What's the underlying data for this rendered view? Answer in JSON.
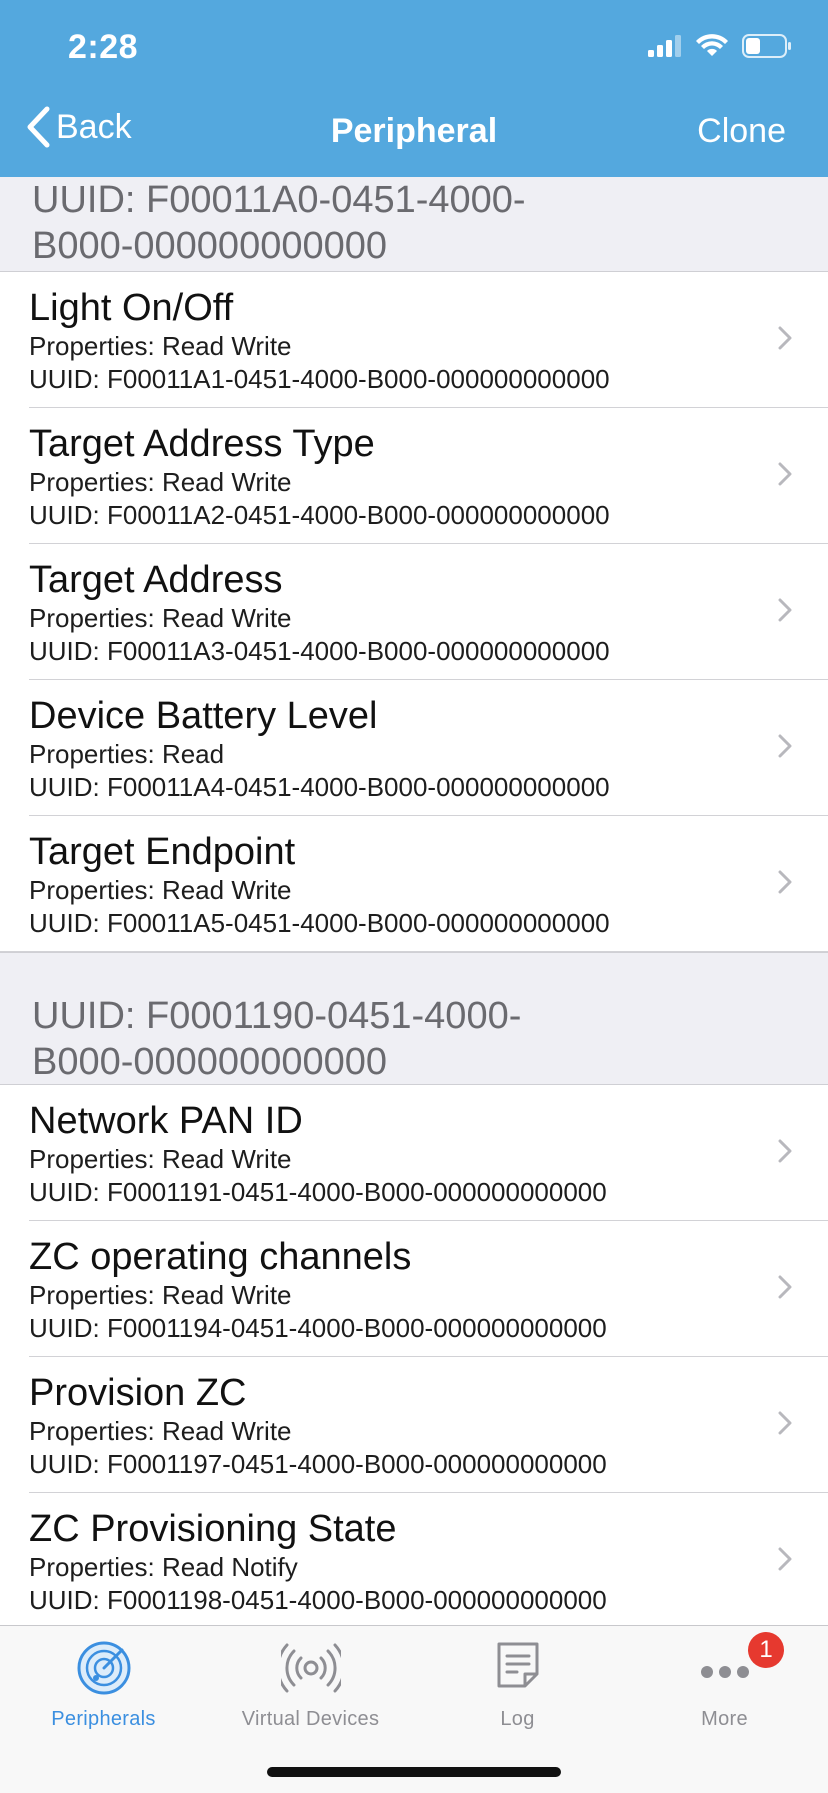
{
  "status_bar": {
    "time": "2:28"
  },
  "nav": {
    "back_label": "Back",
    "title": "Peripheral",
    "action_label": "Clone"
  },
  "sections": [
    {
      "header": "UUID: F00011A0-0451-4000-B000-000000000000",
      "header_line1": "UUID: F00011A0-0451-4000-",
      "header_line2": "B000-000000000000",
      "items": [
        {
          "title": "Light On/Off",
          "properties": "Properties: Read Write",
          "uuid": "UUID: F00011A1-0451-4000-B000-000000000000"
        },
        {
          "title": "Target Address Type",
          "properties": "Properties: Read Write",
          "uuid": "UUID: F00011A2-0451-4000-B000-000000000000"
        },
        {
          "title": "Target Address",
          "properties": "Properties: Read Write",
          "uuid": "UUID: F00011A3-0451-4000-B000-000000000000"
        },
        {
          "title": "Device Battery Level",
          "properties": "Properties: Read",
          "uuid": "UUID: F00011A4-0451-4000-B000-000000000000"
        },
        {
          "title": "Target Endpoint",
          "properties": "Properties: Read Write",
          "uuid": "UUID: F00011A5-0451-4000-B000-000000000000"
        }
      ]
    },
    {
      "header": "UUID: F0001190-0451-4000-B000-000000000000",
      "header_line1": "UUID: F0001190-0451-4000-",
      "header_line2": "B000-000000000000",
      "items": [
        {
          "title": "Network PAN ID",
          "properties": "Properties: Read Write",
          "uuid": "UUID: F0001191-0451-4000-B000-000000000000"
        },
        {
          "title": "ZC operating channels",
          "properties": "Properties: Read Write",
          "uuid": "UUID: F0001194-0451-4000-B000-000000000000"
        },
        {
          "title": "Provision ZC",
          "properties": "Properties: Read Write",
          "uuid": "UUID: F0001197-0451-4000-B000-000000000000"
        },
        {
          "title": "ZC Provisioning State",
          "properties": "Properties: Read Notify",
          "uuid": "UUID: F0001198-0451-4000-B000-000000000000"
        }
      ]
    }
  ],
  "tabs": [
    {
      "label": "Peripherals",
      "icon": "radar-icon",
      "active": true
    },
    {
      "label": "Virtual Devices",
      "icon": "broadcast-icon",
      "active": false
    },
    {
      "label": "Log",
      "icon": "document-icon",
      "active": false
    },
    {
      "label": "More",
      "icon": "ellipsis-icon",
      "active": false,
      "badge": "1"
    }
  ],
  "colors": {
    "header_bg": "#54a8de",
    "tab_active": "#3b8fe0",
    "badge": "#e6392f",
    "section_bg": "#efeff4"
  }
}
